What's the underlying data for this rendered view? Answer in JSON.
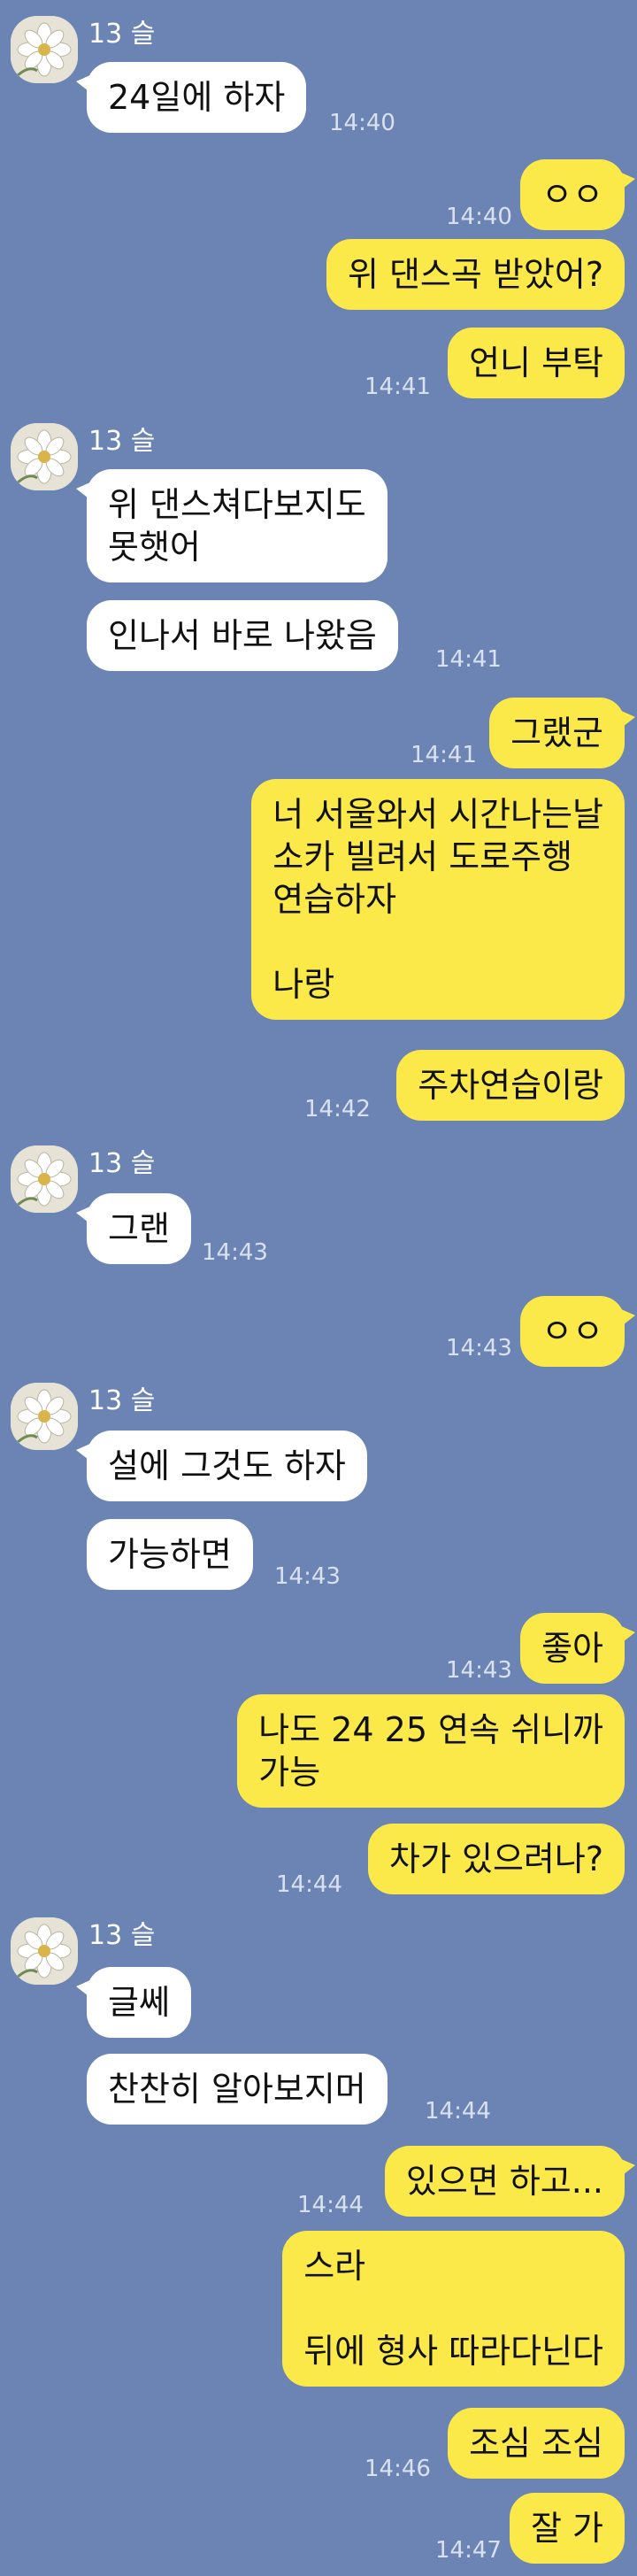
{
  "sender_name": "13 슬",
  "avatar_icon": "flower-icon",
  "colors": {
    "background": "#6b84b3",
    "incoming": "#ffffff",
    "outgoing": "#fbe94a"
  },
  "messages": [
    {
      "text": "24일에 하자",
      "time": "14:40"
    },
    {
      "text": "ㅇㅇ",
      "time": "14:40"
    },
    {
      "text": "위 댄스곡 받았어?"
    },
    {
      "text": "언니 부탁",
      "time": "14:41"
    },
    {
      "text": "위 댄스쳐다보지도\n못햇어"
    },
    {
      "text": "인나서 바로 나왔음",
      "time": "14:41"
    },
    {
      "text": "그랬군",
      "time": "14:41"
    },
    {
      "text": "너 서울와서 시간나는날\n소카 빌려서 도로주행\n연습하자\n\n나랑"
    },
    {
      "text": "주차연습이랑",
      "time": "14:42"
    },
    {
      "text": "그랜",
      "time": "14:43"
    },
    {
      "text": "ㅇㅇ",
      "time": "14:43"
    },
    {
      "text": "설에 그것도 하자"
    },
    {
      "text": "가능하면",
      "time": "14:43"
    },
    {
      "text": "좋아",
      "time": "14:43"
    },
    {
      "text": "나도 24 25 연속 쉬니까\n가능"
    },
    {
      "text": "차가 있으려나?",
      "time": "14:44"
    },
    {
      "text": "글쎄"
    },
    {
      "text": "찬찬히 알아보지머",
      "time": "14:44"
    },
    {
      "text": "있으면 하고...",
      "time": "14:44"
    },
    {
      "text": "스라\n\n뒤에 형사 따라다닌다"
    },
    {
      "text": "조심 조심",
      "time": "14:46"
    },
    {
      "text": "잘 가",
      "time": "14:47"
    }
  ]
}
